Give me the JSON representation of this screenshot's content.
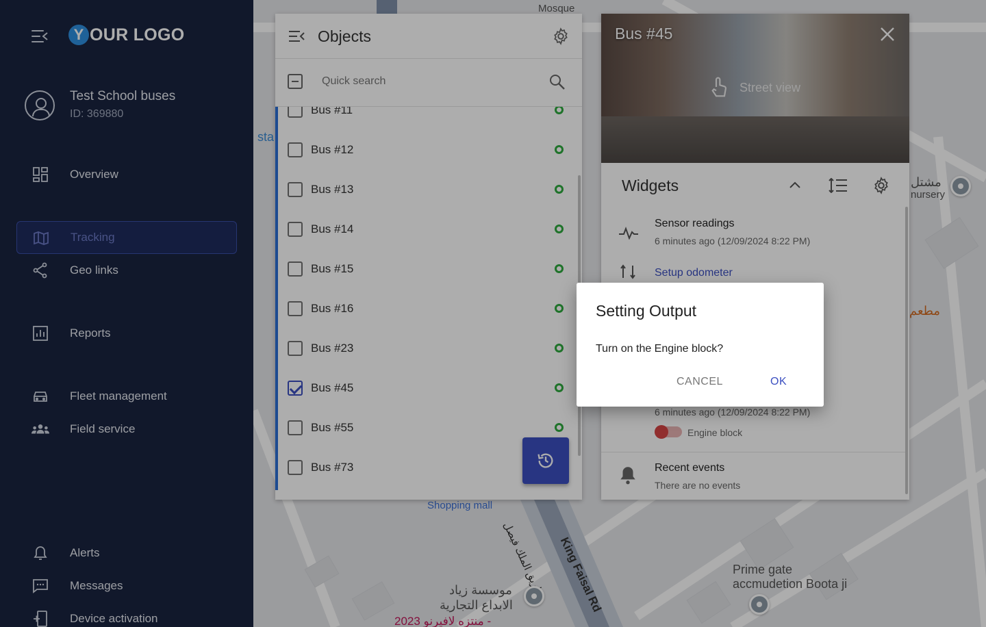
{
  "app": {
    "logo_y": "Y",
    "logo_rest": "OUR LOGO"
  },
  "account": {
    "name": "Test School buses",
    "id": "ID: 369880"
  },
  "nav": [
    {
      "label": "Overview",
      "icon": "dashboard-icon",
      "active": false
    },
    {
      "label": "Tracking",
      "icon": "map-icon",
      "active": true
    },
    {
      "label": "Geo links",
      "icon": "share-icon",
      "active": false
    },
    {
      "label": "Reports",
      "icon": "chart-icon",
      "active": false
    },
    {
      "label": "Fleet management",
      "icon": "car-icon",
      "active": false
    },
    {
      "label": "Field service",
      "icon": "group-icon",
      "active": false
    },
    {
      "label": "Alerts",
      "icon": "bell-icon",
      "active": false
    },
    {
      "label": "Messages",
      "icon": "message-icon",
      "active": false
    },
    {
      "label": "Device activation",
      "icon": "device-add-icon",
      "active": false
    }
  ],
  "objects": {
    "title": "Objects",
    "search_placeholder": "Quick search",
    "items": [
      {
        "name": "Bus #11",
        "checked": false
      },
      {
        "name": "Bus #12",
        "checked": false
      },
      {
        "name": "Bus #13",
        "checked": false
      },
      {
        "name": "Bus #14",
        "checked": false
      },
      {
        "name": "Bus #15",
        "checked": false
      },
      {
        "name": "Bus #16",
        "checked": false
      },
      {
        "name": "Bus #23",
        "checked": false
      },
      {
        "name": "Bus #45",
        "checked": true
      },
      {
        "name": "Bus #55",
        "checked": false
      },
      {
        "name": "Bus #73",
        "checked": false
      }
    ]
  },
  "bus": {
    "title": "Bus #45",
    "street_view": "Street view",
    "widgets_title": "Widgets",
    "sensor_title": "Sensor readings",
    "sensor_sub": "6 minutes ago (12/09/2024 8:22 PM)",
    "odometer_link": "Setup odometer",
    "output_sub": "6 minutes ago (12/09/2024 8:22 PM)",
    "output_toggle": "Engine block",
    "events_title": "Recent events",
    "events_sub": "There are no events"
  },
  "dialog": {
    "title": "Setting Output",
    "message": "Turn on the Engine block?",
    "cancel": "CANCEL",
    "ok": "OK"
  },
  "map": {
    "labels": {
      "mosque": "Mosque",
      "sta": "sta",
      "nursery_ar": "مشتل",
      "nursery": "nursery",
      "restaurant_ar": "مطعم",
      "shopping_mall": "Shopping mall",
      "king_faisal": "King Faisal Rd",
      "king_faisal_ar": "طريق الملك فيصل",
      "prime_gate": "Prime gate",
      "prime_gate_2": "accmudetion Boota ji",
      "zyad_1": "موسسة زياد",
      "zyad_2": "الابداع التجارية",
      "park": "منتزه لافيرنو 2023 -"
    }
  }
}
